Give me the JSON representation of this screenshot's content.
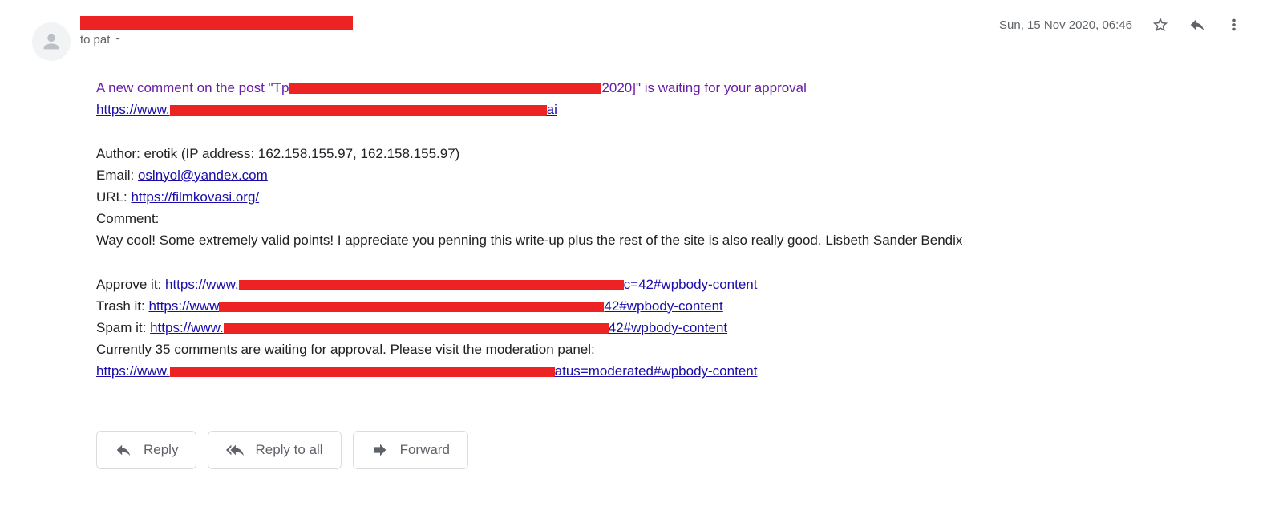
{
  "header": {
    "timestamp": "Sun, 15 Nov 2020, 06:46",
    "recipient_prefix": "to",
    "recipient": "pat"
  },
  "body": {
    "intro_prefix": "A new comment on the post \"T",
    "intro_mid": "p",
    "intro_fragment": "2020]\" is waiting for your approval",
    "link1_prefix": "https://www.",
    "link1_suffix": "ai",
    "author_line": "Author: erotik (IP address: 162.158.155.97, 162.158.155.97)",
    "email_label": "Email: ",
    "email_link": "oslnyol@yandex.com",
    "url_label": "URL: ",
    "url_link": "https://filmkovasi.org/",
    "comment_label": "Comment:",
    "comment_text": "Way cool! Some extremely valid points! I appreciate you penning this write-up plus the rest of the site is also really good. Lisbeth Sander Bendix",
    "approve_label": "Approve it: ",
    "approve_prefix": "https://www.",
    "approve_suffix": "c=42#wpbody-content",
    "trash_label": "Trash it: ",
    "trash_prefix": "https://www",
    "trash_suffix": "42#wpbody-content",
    "spam_label": "Spam it: ",
    "spam_prefix": "https://www.",
    "spam_suffix": "42#wpbody-content",
    "pending_text": "Currently 35 comments are waiting for approval. Please visit the moderation panel:",
    "mod_prefix": "https://www.",
    "mod_mid": "atus=moderated#wpbody-content"
  },
  "actions": {
    "reply": "Reply",
    "reply_all": "Reply to all",
    "forward": "Forward"
  }
}
